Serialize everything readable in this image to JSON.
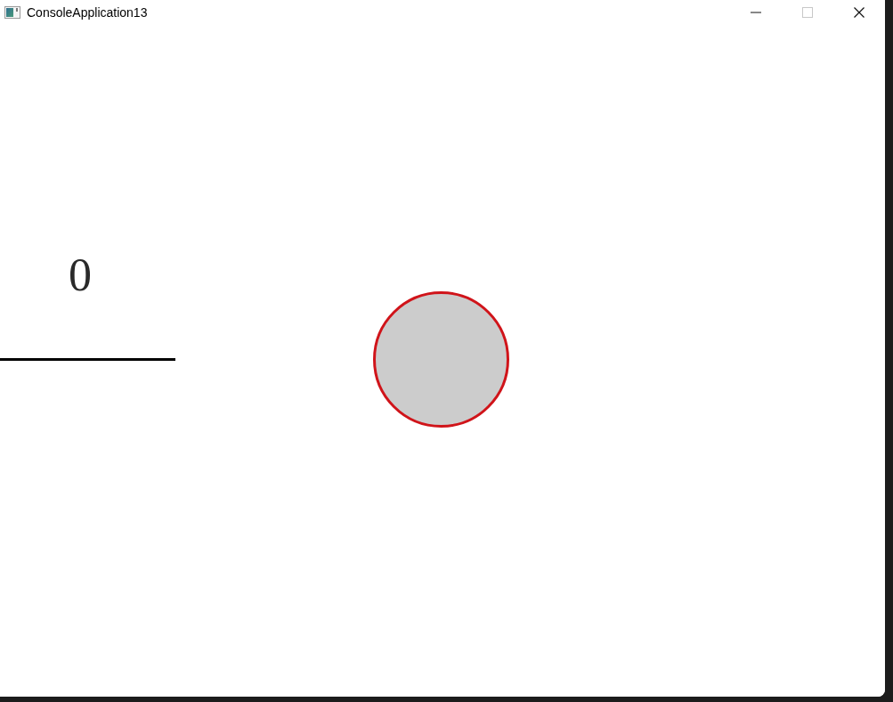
{
  "window": {
    "title": "ConsoleApplication13"
  },
  "canvas": {
    "score": "0"
  }
}
